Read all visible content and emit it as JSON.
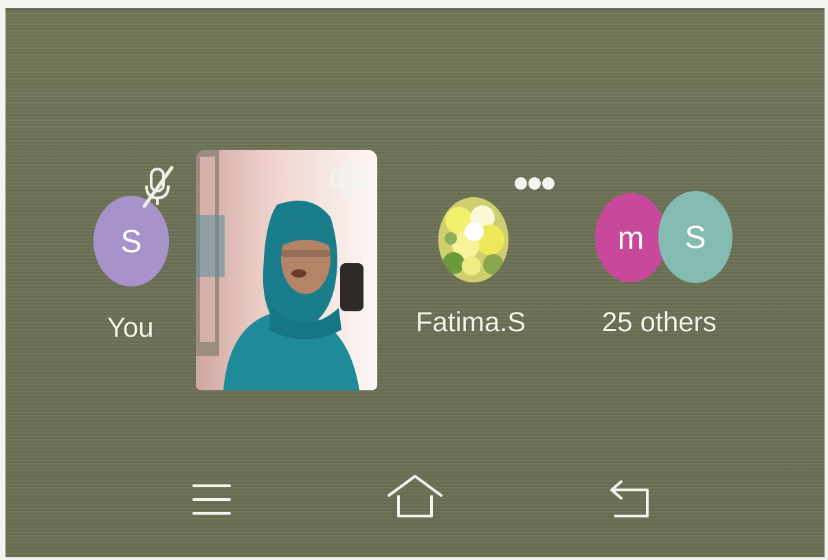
{
  "participants": {
    "self": {
      "initial": "S",
      "label": "You",
      "avatar_color": "#a792c9",
      "mic_state": "muted",
      "icon": "mic-off-icon"
    },
    "video": {
      "icon": "speaking-indicator-icon"
    },
    "fatima": {
      "label": "Fatima.S",
      "avatar": "flower-photo",
      "icon": "more-dots-icon"
    },
    "others": {
      "initial_a": "m",
      "initial_b": "S",
      "label": "25 others",
      "color_a": "#c8489b",
      "color_b": "#84bbb2"
    }
  },
  "nav": {
    "icons": [
      "menu-icon",
      "home-icon",
      "back-icon"
    ]
  }
}
